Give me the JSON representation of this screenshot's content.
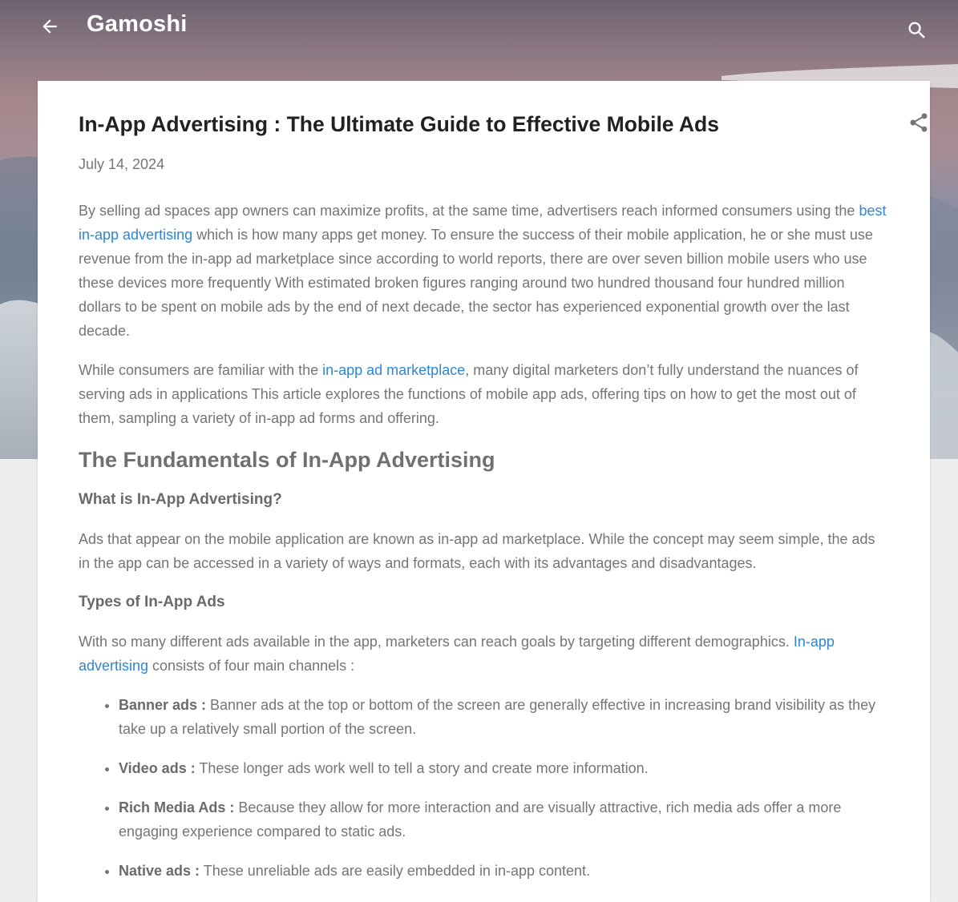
{
  "header": {
    "brand": "Gamoshi",
    "back_icon": "arrow-left-icon",
    "search_icon": "search-icon"
  },
  "post": {
    "title": "In-App Advertising : The Ultimate Guide to Effective Mobile Ads",
    "date": "July 14, 2024",
    "share_icon": "share-icon",
    "p1": {
      "before": "By selling ad spaces app owners can maximize profits, at the same time, advertisers reach informed consumers using the ",
      "link": "best in-app advertising",
      "after": " which is how many apps get money. To ensure the success of their mobile application, he or she must use revenue from the in-app ad marketplace since according to world reports, there are over seven billion mobile users who use these devices more frequently With estimated broken figures ranging around two hundred thousand four hundred million dollars to be spent on mobile ads by the end of next decade, the sector has experienced exponential growth over the last decade."
    },
    "p2": {
      "before": "While consumers are familiar with the ",
      "link": "in-app ad marketplace",
      "after": ", many digital marketers don’t fully understand the nuances of serving ads in applications This article explores the functions of mobile app ads, offering tips on how to get the most out of them, sampling a variety of in-app ad forms and offering."
    },
    "h2_fundamentals": "The Fundamentals of In-App Advertising",
    "h3_what": "What is In-App Advertising?",
    "p3": "Ads that appear on the mobile application are known as in-app ad marketplace. While the concept may seem simple, the ads in the app can be accessed in a variety of ways and formats, each with its advantages and disadvantages.",
    "h3_types": "Types of In-App Ads",
    "p4": {
      "before": "With so many different ads available in the app, marketers can reach goals by targeting different demographics. ",
      "link": "In-app advertising",
      "after": " consists of four main channels :"
    },
    "ad_types": [
      {
        "label": "Banner ads :",
        "text": " Banner ads at the top or bottom of the screen are generally effective in increasing brand visibility as they take up a relatively small portion of the screen."
      },
      {
        "label": "Video ads :",
        "text": " These longer ads work well to tell a story and create more information."
      },
      {
        "label": "Rich Media Ads :",
        "text": " Because they allow for more interaction and are visually attractive, rich media ads offer a more engaging experience compared to static ads."
      },
      {
        "label": "Native ads :",
        "text": " These unreliable ads are easily embedded in in-app content."
      }
    ]
  },
  "colors": {
    "link": "#2f86d6",
    "title": "#212121",
    "body_text": "#757575",
    "page_bg": "#eeeeee"
  }
}
